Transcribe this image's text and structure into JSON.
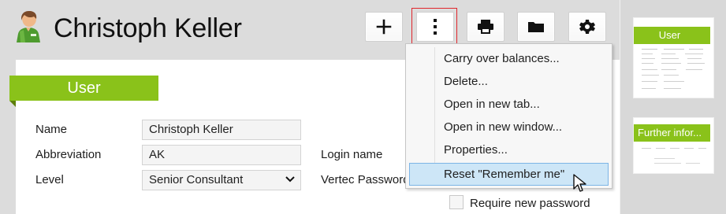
{
  "header": {
    "title": "Christoph Keller",
    "actions": [
      {
        "name": "add",
        "icon": "plus-icon"
      },
      {
        "name": "more",
        "icon": "vertical-ellipsis-icon"
      },
      {
        "name": "print",
        "icon": "printer-icon"
      },
      {
        "name": "folder",
        "icon": "folder-icon"
      },
      {
        "name": "settings",
        "icon": "gear-icon"
      }
    ],
    "highlight_color": "#e0262d"
  },
  "section": {
    "title": "User",
    "accent_color": "#8ac21a"
  },
  "form": {
    "name_label": "Name",
    "name_value": "Christoph Keller",
    "abbreviation_label": "Abbreviation",
    "abbreviation_value": "AK",
    "level_label": "Level",
    "level_value": "Senior Consultant",
    "login_label": "Login name",
    "password_label": "Vertec Password",
    "require_new_password_label": "Require new password",
    "require_new_password_checked": false
  },
  "context_menu": {
    "items": [
      "Carry over balances...",
      "Delete...",
      "Open in new tab...",
      "Open in new window...",
      "Properties...",
      "Reset \"Remember me\""
    ],
    "selected_item": "Reset \"Remember me\""
  },
  "thumbnails": [
    {
      "title": "User"
    },
    {
      "title": "Further infor..."
    }
  ]
}
